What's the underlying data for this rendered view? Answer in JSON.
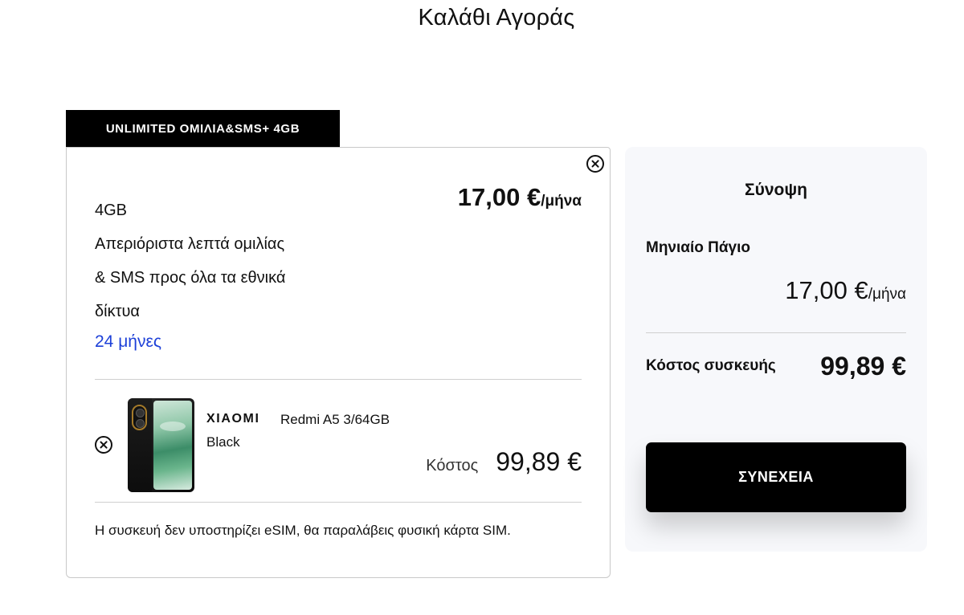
{
  "page": {
    "title": "Καλάθι Αγοράς"
  },
  "plan": {
    "tag": "UNLIMITED ΟΜΙΛΙΑ&SMS+ 4GB",
    "features": [
      "4GB",
      "Απεριόριστα λεπτά ομιλίας",
      "& SMS προς όλα τα εθνικά",
      "δίκτυα"
    ],
    "duration": "24 μήνες",
    "price": "17,00 €",
    "price_period": "/μήνα"
  },
  "device": {
    "brand": "XIAOMI",
    "model": "Redmi A5 3/64GB",
    "color": "Black",
    "cost_label": "Κόστος",
    "cost_value": "99,89 €",
    "esim_note": "Η συσκευή δεν υποστηρίζει eSIM, θα παραλάβεις φυσική κάρτα SIM."
  },
  "summary": {
    "title": "Σύνοψη",
    "monthly_label": "Μηνιαίο Πάγιο",
    "monthly_price": "17,00 €",
    "monthly_period": "/μήνα",
    "device_cost_label": "Κόστος συσκευής",
    "device_cost_value": "99,89 €",
    "continue_label": "ΣΥΝΕΧΕΙΑ"
  },
  "icons": {
    "plan_remove": "close-circle-icon",
    "device_remove": "close-circle-icon"
  },
  "colors": {
    "accent_link": "#1d40d8",
    "primary_button": "#000000",
    "summary_bg": "#f7f8fb"
  }
}
